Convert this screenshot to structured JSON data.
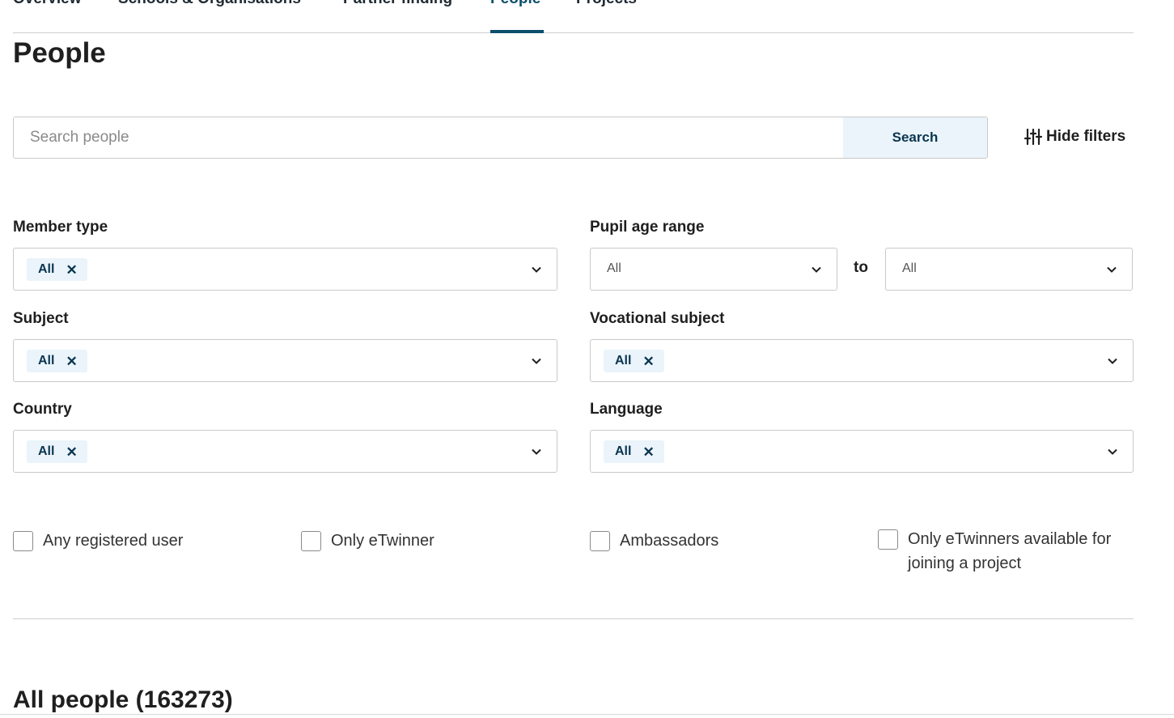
{
  "tabs": [
    {
      "label": "Overview",
      "active": false
    },
    {
      "label": "Schools & Organisations",
      "active": false
    },
    {
      "label": "Partner finding",
      "active": false
    },
    {
      "label": "People",
      "active": true
    },
    {
      "label": "Projects",
      "active": false
    }
  ],
  "page": {
    "title": "People"
  },
  "search": {
    "placeholder": "Search people",
    "value": "",
    "button_label": "Search"
  },
  "hide_filters": {
    "label": "Hide filters",
    "icon": "sliders-icon"
  },
  "filters": {
    "member_type": {
      "label": "Member type",
      "chip": "All"
    },
    "pupil_age_range": {
      "label": "Pupil age range",
      "from": "All",
      "to_label": "to",
      "to": "All"
    },
    "subject": {
      "label": "Subject",
      "chip": "All"
    },
    "vocational_subject": {
      "label": "Vocational subject",
      "chip": "All"
    },
    "country": {
      "label": "Country",
      "chip": "All"
    },
    "language": {
      "label": "Language",
      "chip": "All"
    }
  },
  "checkboxes": [
    {
      "label": "Any registered user",
      "checked": false
    },
    {
      "label": "Only eTwinner",
      "checked": false
    },
    {
      "label": "Ambassadors",
      "checked": false
    },
    {
      "label": "Only eTwinners available for joining a project",
      "checked": false
    }
  ],
  "results": {
    "title": "All people (163273)"
  },
  "colors": {
    "accent": "#0b4f6c",
    "chip_bg": "#eaf4fa",
    "border": "#c9c9c9"
  }
}
